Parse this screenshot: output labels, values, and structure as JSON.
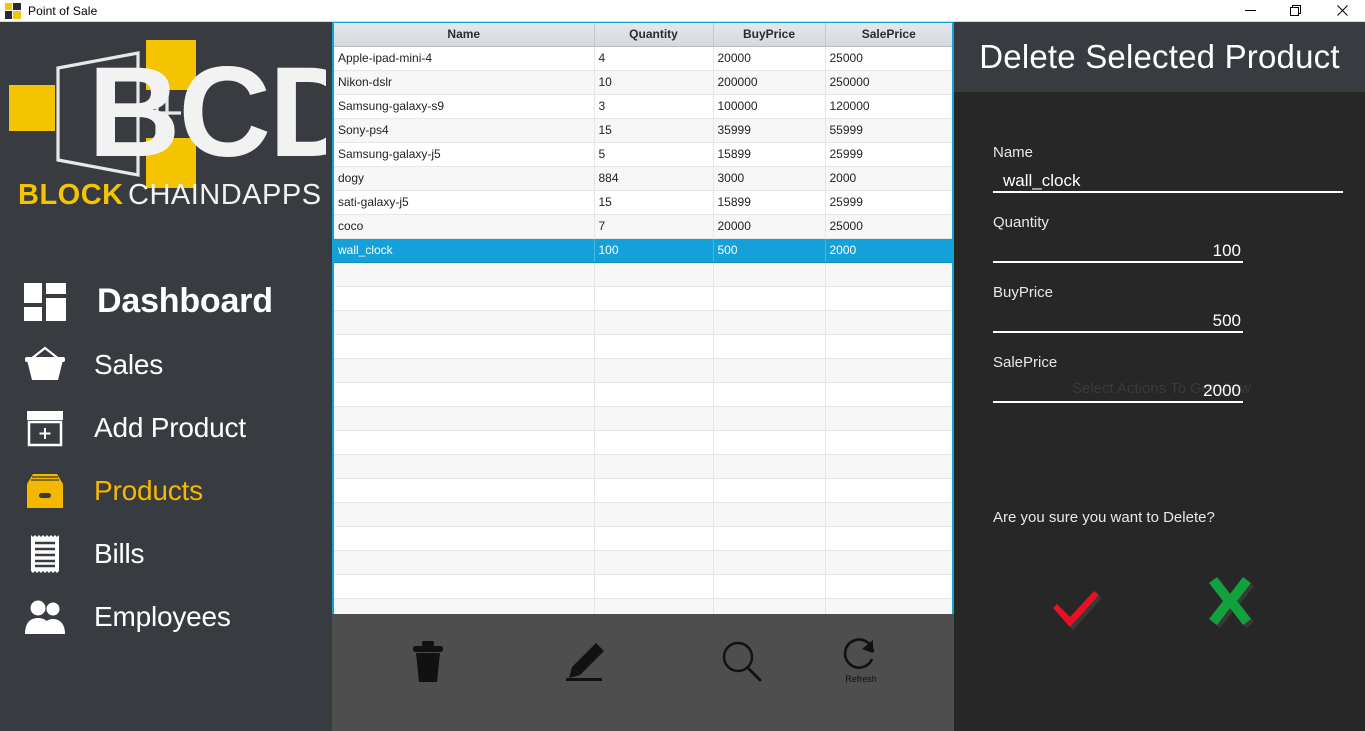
{
  "window": {
    "title": "Point of Sale",
    "app_icon": "app-logo-icon",
    "minimize_label": "Minimize",
    "maximize_label": "Restore",
    "close_label": "Close"
  },
  "brand": {
    "logo_text_main": "BCD",
    "logo_text_bold": "BLOCK",
    "logo_text_light": "CHAINDAPPS",
    "accent_yellow": "#f5c400",
    "panel_dark": "#383c40",
    "body_dark": "#272727",
    "selection_blue": "#14a0d8"
  },
  "sidebar": {
    "items": [
      {
        "label": "Dashboard",
        "icon": "dashboard-grid-icon",
        "active": false
      },
      {
        "label": "Sales",
        "icon": "basket-icon",
        "active": false
      },
      {
        "label": "Add Product",
        "icon": "box-plus-icon",
        "active": false
      },
      {
        "label": "Products",
        "icon": "product-box-icon",
        "active": true
      },
      {
        "label": "Bills",
        "icon": "receipt-icon",
        "active": false
      },
      {
        "label": "Employees",
        "icon": "people-icon",
        "active": false
      }
    ]
  },
  "table": {
    "columns": [
      "Name",
      "Quantity",
      "BuyPrice",
      "SalePrice"
    ],
    "rows": [
      {
        "name": "Apple-ipad-mini-4",
        "quantity": "4",
        "buyprice": "20000",
        "saleprice": "25000",
        "selected": false
      },
      {
        "name": "Nikon-dslr",
        "quantity": "10",
        "buyprice": "200000",
        "saleprice": "250000",
        "selected": false
      },
      {
        "name": "Samsung-galaxy-s9",
        "quantity": "3",
        "buyprice": "100000",
        "saleprice": "120000",
        "selected": false
      },
      {
        "name": "Sony-ps4",
        "quantity": "15",
        "buyprice": "35999",
        "saleprice": "55999",
        "selected": false
      },
      {
        "name": "Samsung-galaxy-j5",
        "quantity": "5",
        "buyprice": "15899",
        "saleprice": "25999",
        "selected": false
      },
      {
        "name": "dogy",
        "quantity": "884",
        "buyprice": "3000",
        "saleprice": "2000",
        "selected": false
      },
      {
        "name": "sati-galaxy-j5",
        "quantity": "15",
        "buyprice": "15899",
        "saleprice": "25999",
        "selected": false
      },
      {
        "name": "coco",
        "quantity": "7",
        "buyprice": "20000",
        "saleprice": "25000",
        "selected": false
      },
      {
        "name": "wall_clock",
        "quantity": "100",
        "buyprice": "500",
        "saleprice": "2000",
        "selected": true
      }
    ],
    "empty_row_count": 15
  },
  "toolbar": {
    "buttons": [
      {
        "icon": "trash-icon",
        "label": ""
      },
      {
        "icon": "pencil-icon",
        "label": ""
      },
      {
        "icon": "search-icon",
        "label": ""
      },
      {
        "icon": "refresh-icon",
        "label": "Refresh"
      }
    ]
  },
  "right_panel": {
    "title": "Delete Selected Product",
    "ghost_text": "Select Actions To Get View",
    "fields": [
      {
        "label": "Name",
        "value": "wall_clock",
        "align": "left"
      },
      {
        "label": "Quantity",
        "value": "100",
        "align": "right"
      },
      {
        "label": "BuyPrice",
        "value": "500",
        "align": "right"
      },
      {
        "label": "SalePrice",
        "value": "2000",
        "align": "right"
      }
    ],
    "confirm_question": "Are you sure you want to Delete?",
    "confirm_yes_icon": "red-check-icon",
    "confirm_no_icon": "green-cross-icon",
    "confirm_yes_color": "#e81123",
    "confirm_no_color": "#12a23d"
  }
}
